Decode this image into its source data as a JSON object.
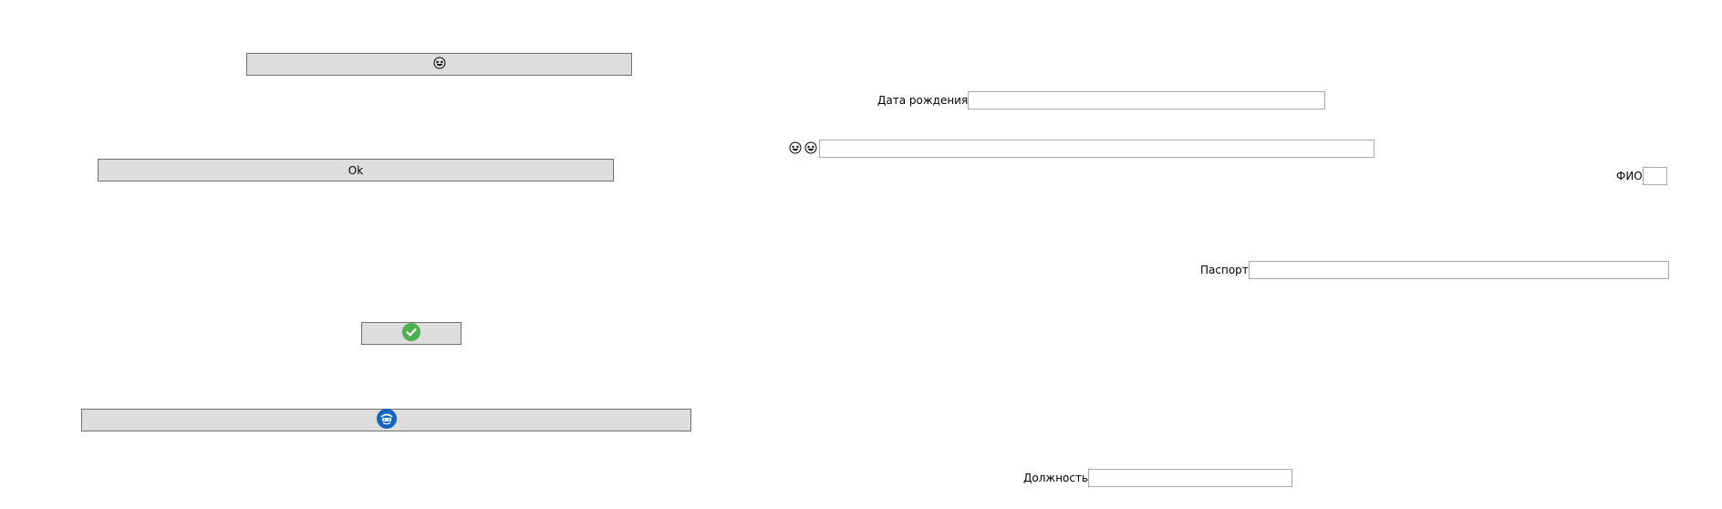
{
  "buttons": {
    "top_icon_button": {
      "icon": "grinning-squint-face-icon"
    },
    "ok_button": {
      "label": "Ok"
    },
    "check_button": {
      "icon": "green-check-circle-icon",
      "color": "#4caf50"
    },
    "bottom_icon_button": {
      "icon": "blue-circle-emblem-icon",
      "color": "#1565c0"
    }
  },
  "form": {
    "birth_date": {
      "label": "Дата рождения",
      "value": ""
    },
    "emoji_field": {
      "icons": [
        "grinning-squint-face-icon",
        "grinning-squint-face-icon"
      ],
      "value": ""
    },
    "fio": {
      "label": "ФИО",
      "value": ""
    },
    "passport": {
      "label": "Паспорт",
      "value": ""
    },
    "position": {
      "label": "Должность",
      "value": ""
    }
  },
  "colors": {
    "button_bg": "#dddddd",
    "button_border": "#707070",
    "input_border": "#a9a9a9"
  }
}
